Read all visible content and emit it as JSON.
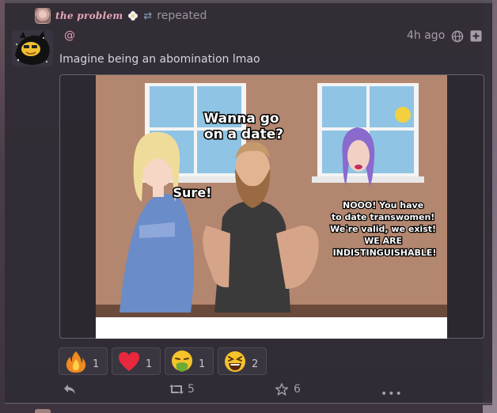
{
  "repeat": {
    "user_name": "the problem",
    "label": "repeated"
  },
  "status": {
    "handle": "@",
    "time": "4h ago",
    "text": "Imagine being an abomination lmao"
  },
  "media": {
    "texts": {
      "speech_1": "Wanna go on a date?",
      "speech_2": "Sure!",
      "speech_3": "NOOO! You have to date transwomen! We're valid, we exist! WE ARE INDISTINGUISHABLE!"
    }
  },
  "reactions": [
    {
      "emoji": "fire-icon",
      "count": "1"
    },
    {
      "emoji": "heart-icon",
      "count": "1"
    },
    {
      "emoji": "vomit-face-icon",
      "count": "1"
    },
    {
      "emoji": "laughing-face-icon",
      "count": "2"
    }
  ],
  "actions": {
    "boost_count": "5",
    "favorite_count": "6"
  },
  "colors": {
    "accent_pink": "#e9a0b4",
    "muted": "#a59eaa",
    "card_bg": "#302c34"
  }
}
